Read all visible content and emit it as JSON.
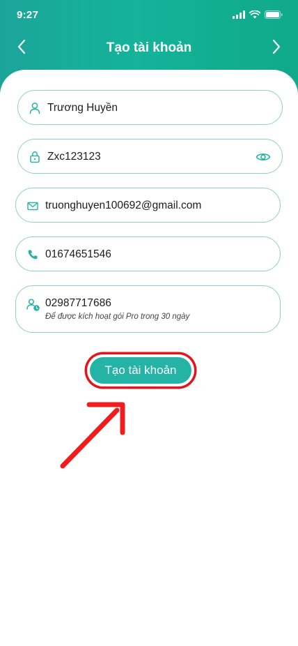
{
  "status_bar": {
    "time": "9:27"
  },
  "header": {
    "title": "Tạo tài khoản"
  },
  "form": {
    "name": {
      "value": "Trương Huyền"
    },
    "password": {
      "value": "Zxc123123"
    },
    "email": {
      "value": "truonghuyen100692@gmail.com"
    },
    "phone": {
      "value": "01674651546"
    },
    "referral": {
      "value": "02987717686",
      "hint": "Để được kích hoạt gói Pro trong 30 ngày"
    }
  },
  "submit_label": "Tạo tài khoản",
  "colors": {
    "accent": "#25b3a6",
    "highlight": "#e3141b",
    "border": "#8fcfcb"
  }
}
